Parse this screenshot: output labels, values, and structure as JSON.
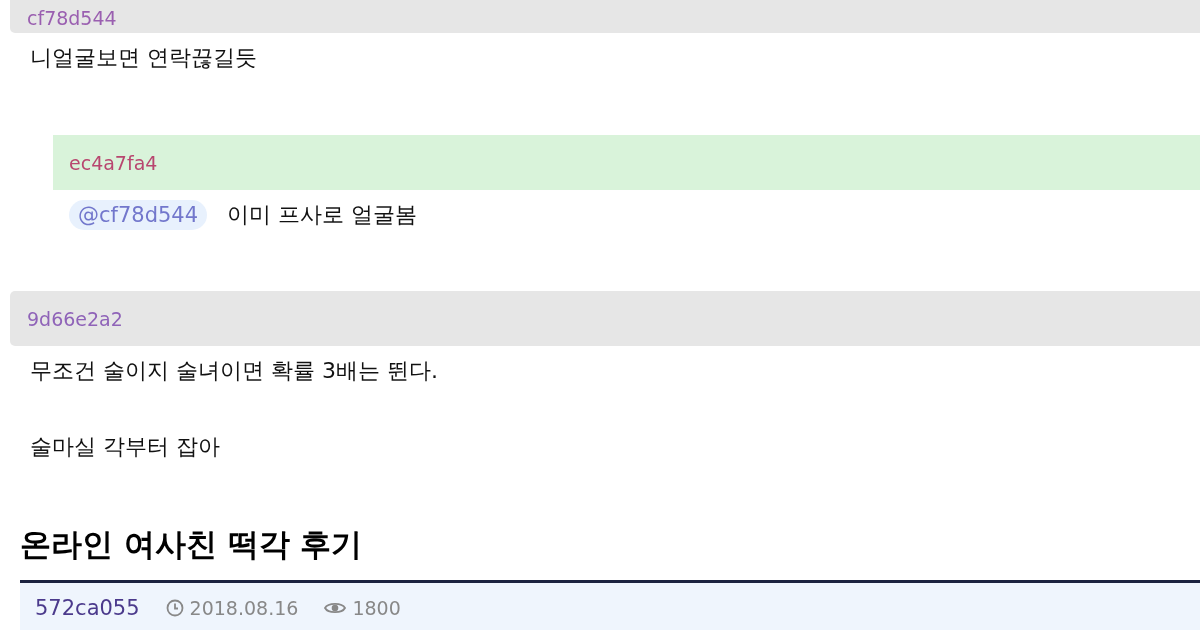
{
  "comments": [
    {
      "author": "cf78d544",
      "color": "#9a5fb0",
      "kind": "comment",
      "lines": [
        "니얼굴보면 연락끊길듯"
      ]
    },
    {
      "author": "ec4a7fa4",
      "color": "#b8466f",
      "kind": "reply",
      "mention": "@cf78d544",
      "lines": [
        "이미 프사로 얼굴봄"
      ]
    },
    {
      "author": "9d66e2a2",
      "color": "#8f63b8",
      "kind": "comment",
      "lines": [
        "무조건 술이지 술녀이면 확률 3배는 뛴다.",
        "술마실 각부터 잡아"
      ]
    }
  ],
  "post": {
    "title": "온라인 여사친 떡각 후기",
    "author": "572ca055",
    "date": "2018.08.16",
    "views": "1800"
  }
}
